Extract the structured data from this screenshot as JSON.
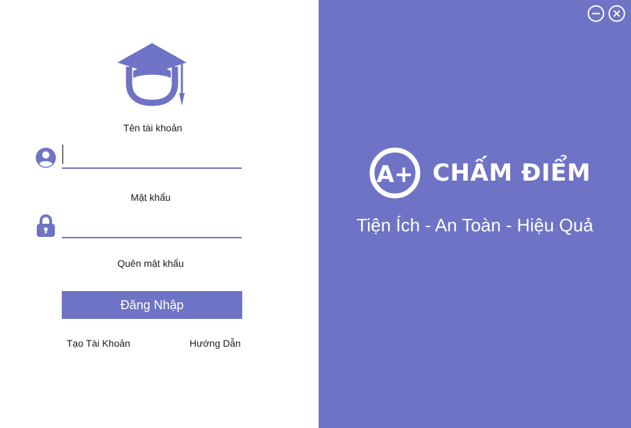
{
  "colors": {
    "accent": "#6e73c5",
    "background": "#ffffff",
    "text": "#1a1a1a"
  },
  "window": {
    "minimize_icon": "minimize-circle-icon",
    "close_icon": "close-circle-icon"
  },
  "login_form": {
    "logo_icon": "graduation-cap-student-icon",
    "username_label": "Tên tài khoản",
    "username_icon": "user-circle-icon",
    "username_value": "",
    "password_label": "Mật khẩu",
    "password_icon": "lock-icon",
    "password_value": "",
    "forgot_label": "Quên mật khẩu",
    "login_button_label": "Đăng Nhập",
    "create_account_label": "Tạo Tài Khoản",
    "guide_label": "Hướng Dẫn"
  },
  "branding": {
    "logo_text": "A+",
    "title": "CHẤM ĐIỂM",
    "tagline": "Tiện Ích - An Toàn - Hiệu Quả"
  }
}
